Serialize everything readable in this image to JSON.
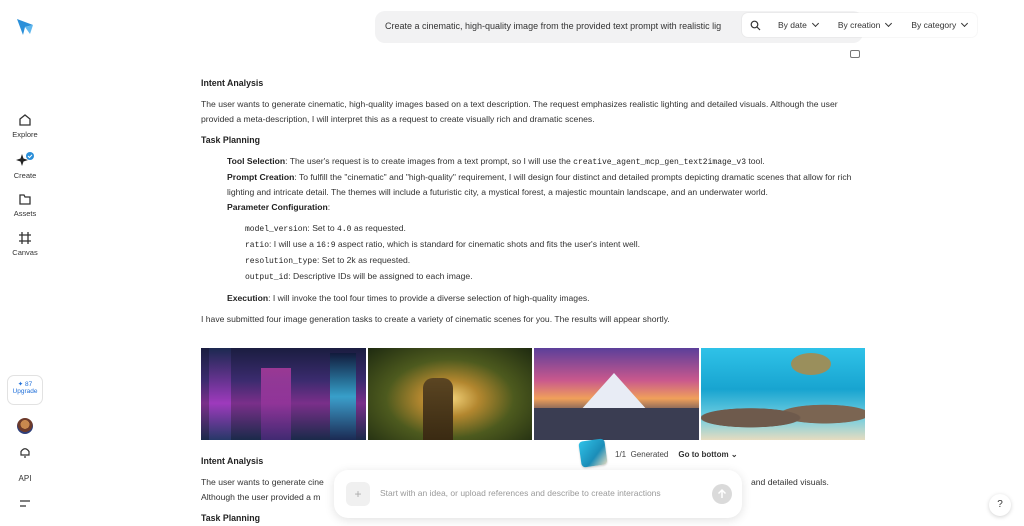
{
  "sidebar": {
    "items": [
      {
        "label": "Explore",
        "icon": "home-icon"
      },
      {
        "label": "Create",
        "icon": "sparkle-icon"
      },
      {
        "label": "Assets",
        "icon": "folder-icon"
      },
      {
        "label": "Canvas",
        "icon": "canvas-icon"
      }
    ],
    "upgrade": {
      "count": "87",
      "label": "Upgrade"
    },
    "api_label": "API"
  },
  "topbar": {
    "prompt": "Create a cinematic, high-quality image from the provided text prompt with realistic lig",
    "filters": [
      "By date",
      "By creation",
      "By category"
    ]
  },
  "message1": {
    "intent_heading": "Intent Analysis",
    "intent_text": "The user wants to generate cinematic, high-quality images based on a text description. The request emphasizes realistic lighting and detailed visuals. Although the user provided a meta-description, I will interpret this as a request to create visually rich and dramatic scenes.",
    "task_heading": "Task Planning",
    "tool_label": "Tool Selection",
    "tool_text": ": The user's request is to create images from a text prompt, so I will use the ",
    "tool_name": "creative_agent_mcp_gen_text2image_v3",
    "tool_end": " tool.",
    "prompt_label": "Prompt Creation",
    "prompt_text": ": To fulfill the \"cinematic\" and \"high-quality\" requirement, I will design four distinct and detailed prompts depicting dramatic scenes that allow for rich lighting and intricate detail. The themes will include a futuristic city, a mystical forest, a majestic mountain landscape, and an underwater world.",
    "param_label": "Parameter Configuration",
    "params": [
      {
        "key": "model_version",
        "pre": ": Set to ",
        "val": "4.0",
        "post": " as requested."
      },
      {
        "key": "ratio",
        "pre": ": I will use a ",
        "val": "16:9",
        "post": " aspect ratio, which is standard for cinematic shots and fits the user's intent well."
      },
      {
        "key": "resolution_type",
        "pre": ": Set to ",
        "val": "2k",
        "post": " as requested."
      },
      {
        "key": "output_id",
        "pre": ": Descriptive IDs will be assigned to each image.",
        "val": "",
        "post": ""
      }
    ],
    "exec_label": "Execution",
    "exec_text": ": I will invoke the tool four times to provide a diverse selection of high-quality images.",
    "summary": "I have submitted four image generation tasks to create a variety of cinematic scenes for you. The results will appear shortly."
  },
  "images": [
    "futuristic city",
    "mystical forest",
    "mountain landscape",
    "underwater world"
  ],
  "message2": {
    "intent_heading": "Intent Analysis",
    "line1_start": "The user wants to generate cine",
    "line1_end": "and detailed visuals.",
    "line2_start": "Although the user provided a m",
    "task_heading": "Task Planning"
  },
  "generated": {
    "count": "1/1",
    "label": "Generated",
    "goto": "Go to bottom"
  },
  "chat": {
    "placeholder": "Start with an idea, or upload references and describe to create interactions"
  },
  "help": "?",
  "colors": {
    "accent": "#1f6fd9",
    "logo": "#2a8fd9"
  }
}
